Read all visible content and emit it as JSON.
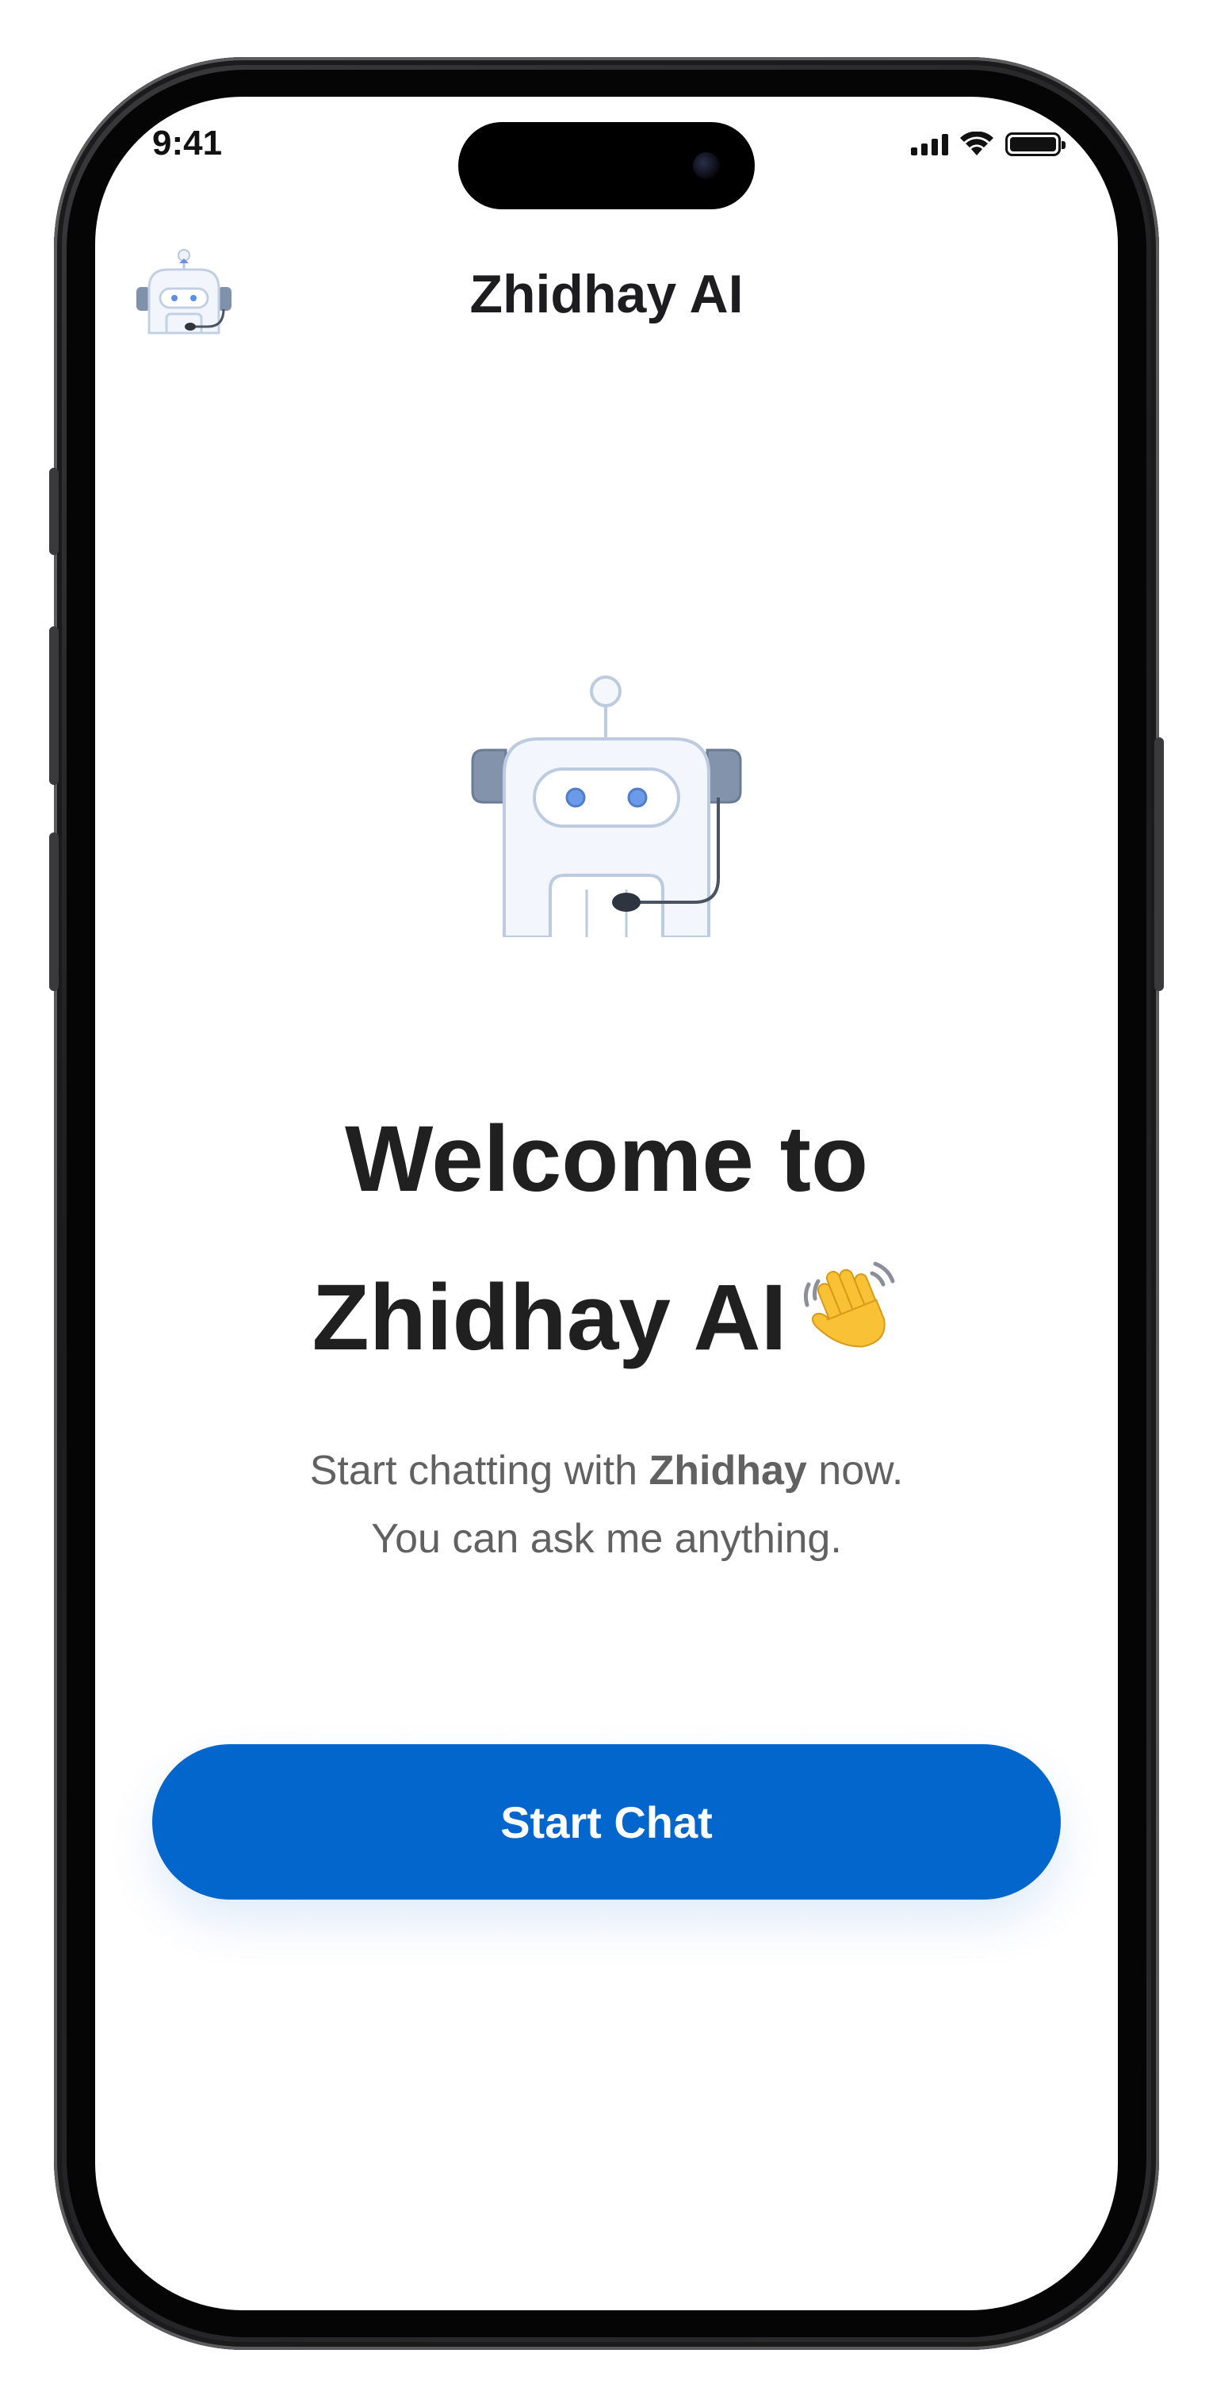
{
  "status_bar": {
    "time": "9:41"
  },
  "header": {
    "title": "Zhidhay AI",
    "avatar_icon": "robot-avatar-icon"
  },
  "hero": {
    "robot_icon": "robot-headset-icon",
    "welcome_line1": "Welcome to",
    "welcome_line2": "Zhidhay AI",
    "wave_icon": "waving-hand-icon",
    "subtitle_part1": "Start chatting with ",
    "subtitle_bold": "Zhidhay",
    "subtitle_part2": " now.",
    "subtitle_line2": "You can ask me anything."
  },
  "actions": {
    "start_chat_label": "Start Chat"
  },
  "colors": {
    "primary": "#0366cc",
    "title_text": "#202020",
    "body_text": "#616161",
    "robot_accent": "#5b8ee6",
    "robot_gray": "#8091ab"
  }
}
